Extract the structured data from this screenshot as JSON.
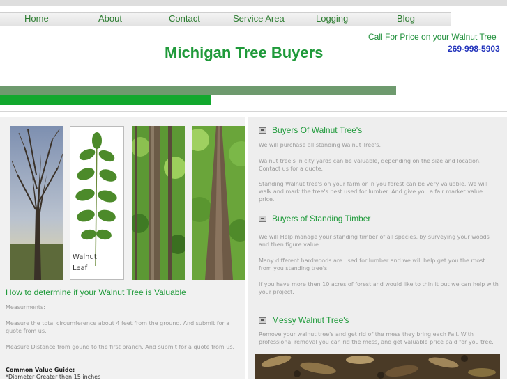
{
  "nav": {
    "items": [
      {
        "label": "Home"
      },
      {
        "label": "About"
      },
      {
        "label": "Contact"
      },
      {
        "label": "Service Area"
      },
      {
        "label": "Logging"
      },
      {
        "label": "Blog"
      }
    ]
  },
  "header": {
    "title": "Michigan Tree Buyers",
    "call": "Call For Price on your Walnut Tree",
    "phone": "269-998-5903"
  },
  "photos": {
    "leaf_caption_1": "Walnut",
    "leaf_caption_2": "Leaf"
  },
  "left": {
    "heading": "How to determine if your Walnut Tree is Valuable",
    "p1": "Measurments:",
    "p2": "Measure the total circumference about 4 feet from the ground. And submit for a quote from us.",
    "p3": "Measure Distance from gound to the first branch. And submit for a quote from us.",
    "guide_title": "Common Value Guide:",
    "guide_item": "*Diameter Greater then 15 inches"
  },
  "right": {
    "sections": [
      {
        "title": "Buyers Of Walnut Tree's",
        "paras": [
          "We will purchase all standing Walnut Tree's.",
          "Walnut tree's in city yards can be valuable, depending on the size and location. Contact us for a quote.",
          "Standing Walnut tree's on your farm or in you forest can be very valuable. We will walk and mark the tree's best used for lumber. And give you a fair market value price."
        ]
      },
      {
        "title": "Buyers of Standing Timber",
        "paras": [
          "We will Help manage your standing timber of all species, by surveying your woods and then figure value.",
          "Many different hardwoods are used for lumber and we will help get you the most from you standing tree's.",
          "If you have more then 10 acres of forest and would like to thin it out we can help with your project."
        ]
      },
      {
        "title": "Messy Walnut Tree's",
        "paras": [
          "Remove your walnut tree's and get rid of the mess they bring each Fall. With professional removal you can rid the mess, and get valuable price paid for you tree."
        ]
      }
    ]
  },
  "colors": {
    "accent_green": "#1e9a3a",
    "bar_dark": "#6e9a6e",
    "bar_bright": "#12a82e",
    "phone_blue": "#2233bb"
  }
}
